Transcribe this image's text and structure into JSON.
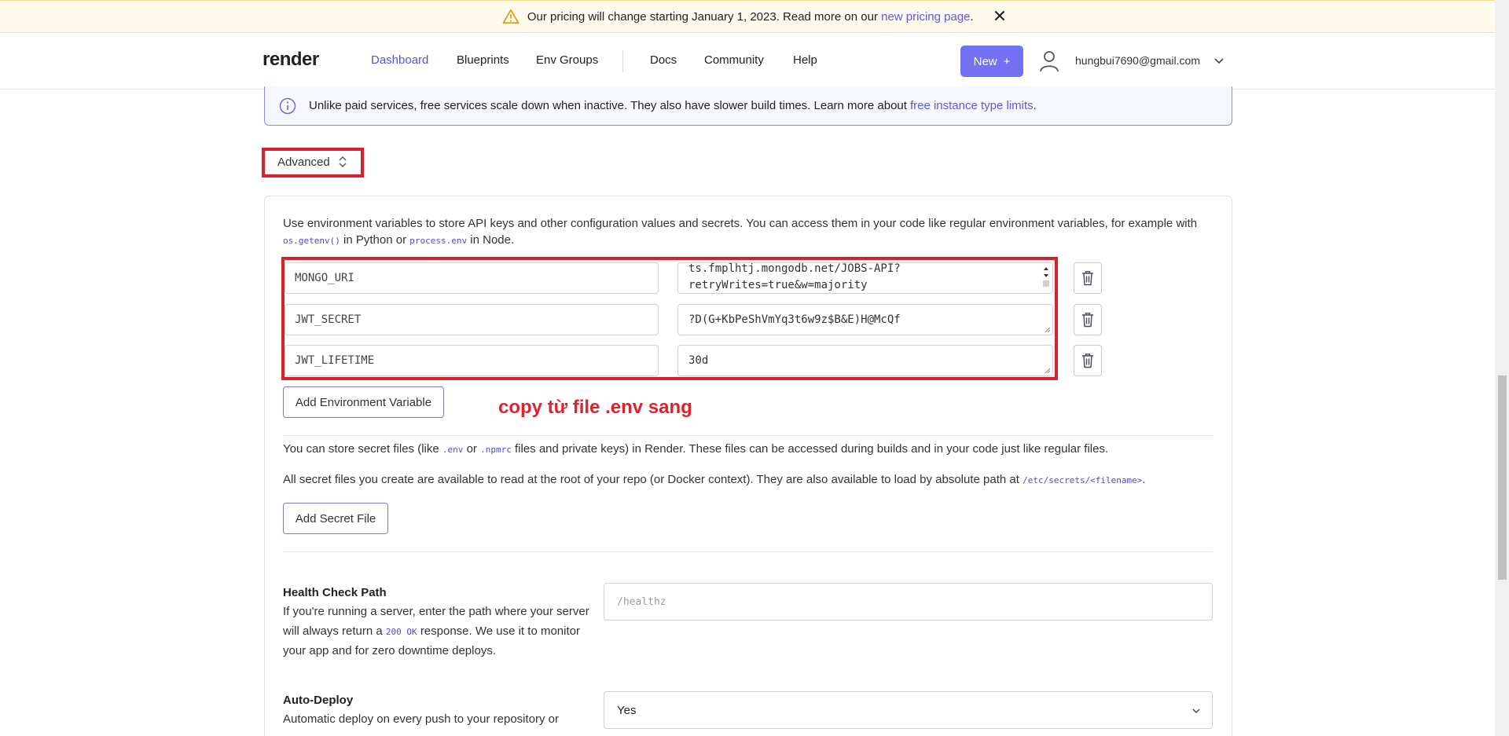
{
  "banner": {
    "text": "Our pricing will change starting January 1, 2023. Read more on our",
    "link": "new pricing page",
    "suffix": ".",
    "close": "✕"
  },
  "nav": {
    "logo": "render",
    "links": [
      "Dashboard",
      "Blueprints",
      "Env Groups",
      "Docs",
      "Community",
      "Help"
    ],
    "active": "Dashboard",
    "new_button": "New",
    "new_plus": "+",
    "user_email": "hungbui7690@gmail.com"
  },
  "info": {
    "text": "Unlike paid services, free services scale down when inactive. They also have slower build times. Learn more about",
    "link": "free instance type limits",
    "suffix": "."
  },
  "advanced": {
    "label": "Advanced"
  },
  "env": {
    "desc_1": "Use environment variables to store API keys and other configuration values and secrets. You can access them in your code like regular environment variables, for example with",
    "code_1": "os.getenv()",
    "desc_2": "in Python or",
    "code_2": "process.env",
    "desc_3": "in Node.",
    "rows": [
      {
        "key": "MONGO_URI",
        "value_line1": "ts.fmplhtj.mongodb.net/JOBS-API?",
        "value_line2": "retryWrites=true&w=majority"
      },
      {
        "key": "JWT_SECRET",
        "value_line1": "?D(G+KbPeShVmYq3t6w9z$B&E)H@McQf",
        "value_line2": ""
      },
      {
        "key": "JWT_LIFETIME",
        "value_line1": "30d",
        "value_line2": ""
      }
    ],
    "add_button": "Add Environment Variable",
    "annotation": "copy  từ file .env sang"
  },
  "secrets": {
    "line1_a": "You can store secret files (like",
    "code_env": ".env",
    "line1_b": "or",
    "code_npmrc": ".npmrc",
    "line1_c": "files and private keys) in Render. These files can be accessed during builds and in your code just like regular files.",
    "line2_a": "All secret files you create are available to read at the root of your repo (or Docker context). They are also available to load by absolute path at",
    "code_path": "/etc/secrets/<filename>",
    "line2_b": ".",
    "add_button": "Add Secret File"
  },
  "health": {
    "label": "Health Check Path",
    "help_a": "If you're running a server, enter the path where your server will always return a",
    "help_code": "200 OK",
    "help_b": "response. We use it to monitor your app and for zero downtime deploys.",
    "placeholder": "/healthz"
  },
  "autodeploy": {
    "label": "Auto-Deploy",
    "help": "Automatic deploy on every push to your repository or",
    "value": "Yes"
  },
  "colors": {
    "accent": "#7370f2",
    "annotation_red": "#d8222b",
    "link": "#5a5ae0"
  }
}
